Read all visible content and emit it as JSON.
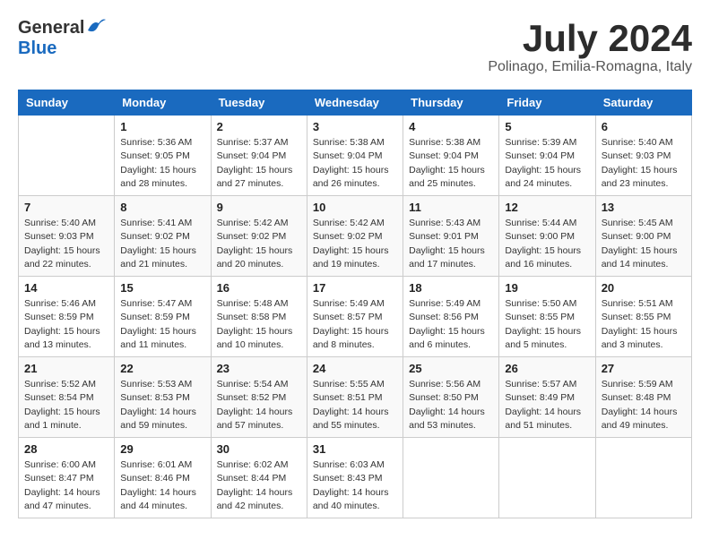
{
  "header": {
    "logo_general": "General",
    "logo_blue": "Blue",
    "title": "July 2024",
    "subtitle": "Polinago, Emilia-Romagna, Italy"
  },
  "weekdays": [
    "Sunday",
    "Monday",
    "Tuesday",
    "Wednesday",
    "Thursday",
    "Friday",
    "Saturday"
  ],
  "weeks": [
    [
      {
        "day": "",
        "info": ""
      },
      {
        "day": "1",
        "info": "Sunrise: 5:36 AM\nSunset: 9:05 PM\nDaylight: 15 hours\nand 28 minutes."
      },
      {
        "day": "2",
        "info": "Sunrise: 5:37 AM\nSunset: 9:04 PM\nDaylight: 15 hours\nand 27 minutes."
      },
      {
        "day": "3",
        "info": "Sunrise: 5:38 AM\nSunset: 9:04 PM\nDaylight: 15 hours\nand 26 minutes."
      },
      {
        "day": "4",
        "info": "Sunrise: 5:38 AM\nSunset: 9:04 PM\nDaylight: 15 hours\nand 25 minutes."
      },
      {
        "day": "5",
        "info": "Sunrise: 5:39 AM\nSunset: 9:04 PM\nDaylight: 15 hours\nand 24 minutes."
      },
      {
        "day": "6",
        "info": "Sunrise: 5:40 AM\nSunset: 9:03 PM\nDaylight: 15 hours\nand 23 minutes."
      }
    ],
    [
      {
        "day": "7",
        "info": "Sunrise: 5:40 AM\nSunset: 9:03 PM\nDaylight: 15 hours\nand 22 minutes."
      },
      {
        "day": "8",
        "info": "Sunrise: 5:41 AM\nSunset: 9:02 PM\nDaylight: 15 hours\nand 21 minutes."
      },
      {
        "day": "9",
        "info": "Sunrise: 5:42 AM\nSunset: 9:02 PM\nDaylight: 15 hours\nand 20 minutes."
      },
      {
        "day": "10",
        "info": "Sunrise: 5:42 AM\nSunset: 9:02 PM\nDaylight: 15 hours\nand 19 minutes."
      },
      {
        "day": "11",
        "info": "Sunrise: 5:43 AM\nSunset: 9:01 PM\nDaylight: 15 hours\nand 17 minutes."
      },
      {
        "day": "12",
        "info": "Sunrise: 5:44 AM\nSunset: 9:00 PM\nDaylight: 15 hours\nand 16 minutes."
      },
      {
        "day": "13",
        "info": "Sunrise: 5:45 AM\nSunset: 9:00 PM\nDaylight: 15 hours\nand 14 minutes."
      }
    ],
    [
      {
        "day": "14",
        "info": "Sunrise: 5:46 AM\nSunset: 8:59 PM\nDaylight: 15 hours\nand 13 minutes."
      },
      {
        "day": "15",
        "info": "Sunrise: 5:47 AM\nSunset: 8:59 PM\nDaylight: 15 hours\nand 11 minutes."
      },
      {
        "day": "16",
        "info": "Sunrise: 5:48 AM\nSunset: 8:58 PM\nDaylight: 15 hours\nand 10 minutes."
      },
      {
        "day": "17",
        "info": "Sunrise: 5:49 AM\nSunset: 8:57 PM\nDaylight: 15 hours\nand 8 minutes."
      },
      {
        "day": "18",
        "info": "Sunrise: 5:49 AM\nSunset: 8:56 PM\nDaylight: 15 hours\nand 6 minutes."
      },
      {
        "day": "19",
        "info": "Sunrise: 5:50 AM\nSunset: 8:55 PM\nDaylight: 15 hours\nand 5 minutes."
      },
      {
        "day": "20",
        "info": "Sunrise: 5:51 AM\nSunset: 8:55 PM\nDaylight: 15 hours\nand 3 minutes."
      }
    ],
    [
      {
        "day": "21",
        "info": "Sunrise: 5:52 AM\nSunset: 8:54 PM\nDaylight: 15 hours\nand 1 minute."
      },
      {
        "day": "22",
        "info": "Sunrise: 5:53 AM\nSunset: 8:53 PM\nDaylight: 14 hours\nand 59 minutes."
      },
      {
        "day": "23",
        "info": "Sunrise: 5:54 AM\nSunset: 8:52 PM\nDaylight: 14 hours\nand 57 minutes."
      },
      {
        "day": "24",
        "info": "Sunrise: 5:55 AM\nSunset: 8:51 PM\nDaylight: 14 hours\nand 55 minutes."
      },
      {
        "day": "25",
        "info": "Sunrise: 5:56 AM\nSunset: 8:50 PM\nDaylight: 14 hours\nand 53 minutes."
      },
      {
        "day": "26",
        "info": "Sunrise: 5:57 AM\nSunset: 8:49 PM\nDaylight: 14 hours\nand 51 minutes."
      },
      {
        "day": "27",
        "info": "Sunrise: 5:59 AM\nSunset: 8:48 PM\nDaylight: 14 hours\nand 49 minutes."
      }
    ],
    [
      {
        "day": "28",
        "info": "Sunrise: 6:00 AM\nSunset: 8:47 PM\nDaylight: 14 hours\nand 47 minutes."
      },
      {
        "day": "29",
        "info": "Sunrise: 6:01 AM\nSunset: 8:46 PM\nDaylight: 14 hours\nand 44 minutes."
      },
      {
        "day": "30",
        "info": "Sunrise: 6:02 AM\nSunset: 8:44 PM\nDaylight: 14 hours\nand 42 minutes."
      },
      {
        "day": "31",
        "info": "Sunrise: 6:03 AM\nSunset: 8:43 PM\nDaylight: 14 hours\nand 40 minutes."
      },
      {
        "day": "",
        "info": ""
      },
      {
        "day": "",
        "info": ""
      },
      {
        "day": "",
        "info": ""
      }
    ]
  ]
}
